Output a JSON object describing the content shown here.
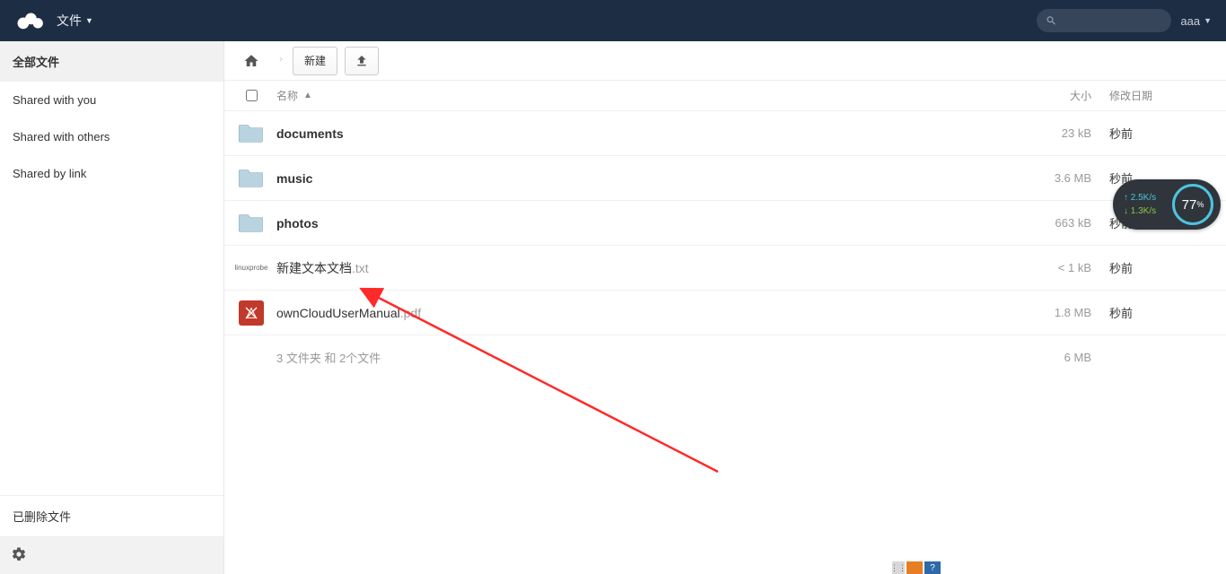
{
  "header": {
    "app_label": "文件",
    "search_placeholder": "",
    "user_name": "aaa"
  },
  "sidebar": {
    "items": [
      {
        "label": "全部文件",
        "active": true
      },
      {
        "label": "Shared with you",
        "active": false
      },
      {
        "label": "Shared with others",
        "active": false
      },
      {
        "label": "Shared by link",
        "active": false
      }
    ],
    "trash_label": "已删除文件"
  },
  "controls": {
    "new_label": "新建"
  },
  "table": {
    "name_header": "名称",
    "sort_indicator": "▲",
    "size_header": "大小",
    "date_header": "修改日期"
  },
  "rows": [
    {
      "type": "folder",
      "name": "documents",
      "ext": "",
      "size": "23 kB",
      "date": "秒前"
    },
    {
      "type": "folder",
      "name": "music",
      "ext": "",
      "size": "3.6 MB",
      "date": "秒前"
    },
    {
      "type": "folder",
      "name": "photos",
      "ext": "",
      "size": "663 kB",
      "date": "秒前"
    },
    {
      "type": "txt",
      "name": "新建文本文档",
      "ext": ".txt",
      "size": "< 1 kB",
      "date": "秒前",
      "badge": "linuxprobe"
    },
    {
      "type": "pdf",
      "name": "ownCloudUserManual",
      "ext": ".pdf",
      "size": "1.8 MB",
      "date": "秒前"
    }
  ],
  "summary": {
    "text": "3 文件夹 和 2个文件",
    "size": "6 MB"
  },
  "gauge": {
    "up": "2.5K/s",
    "down": "1.3K/s",
    "percent": "77",
    "percent_sym": "%"
  }
}
